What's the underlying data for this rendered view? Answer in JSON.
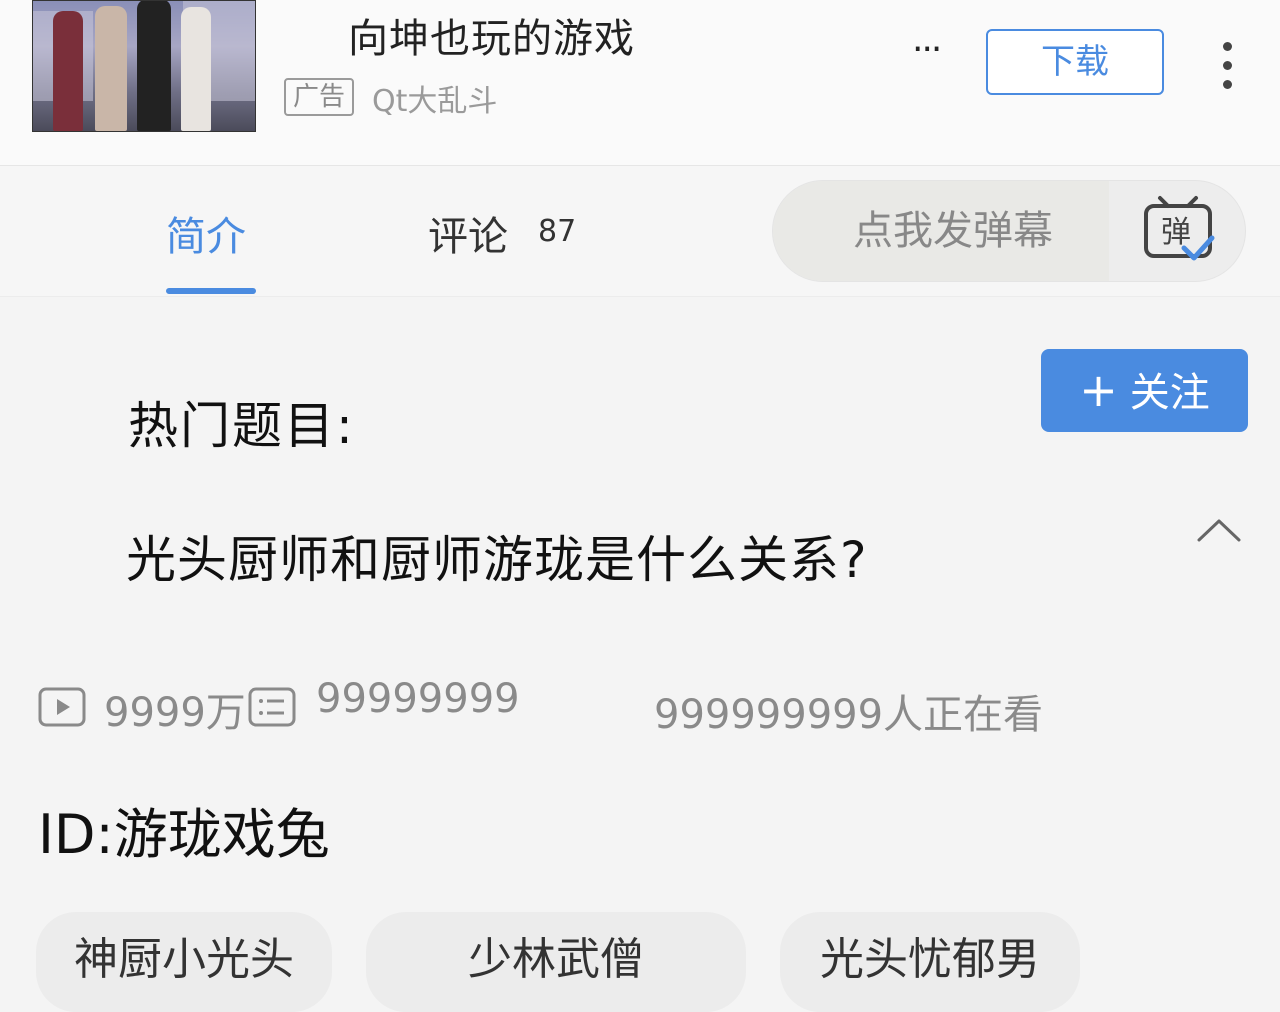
{
  "ad": {
    "title": "向坤也玩的游戏",
    "tag": "广告",
    "brand": "Qt大乱斗",
    "more": "...",
    "download_label": "下载",
    "icons": {
      "more": "ellipsis-icon",
      "menu": "kebab-menu-icon"
    }
  },
  "tabs": {
    "intro_label": "简介",
    "comments_label": "评论",
    "comments_count": "87",
    "danmaku_placeholder": "点我发弹幕",
    "danmaku_icon_glyph": "弹"
  },
  "video": {
    "follow_plus": "+",
    "follow_label": "关注",
    "hot_label": "热门题目:",
    "question": "光头厨师和厨师游珑是什么关系?",
    "views": "9999万",
    "danmu_count": "99999999",
    "watching": "999999999人正在看",
    "id_line": "ID:游珑戏兔",
    "tags": [
      "神厨小光头",
      "少林武僧",
      "光头忧郁男"
    ]
  },
  "colors": {
    "accent": "#4a8be0",
    "background": "#f4f4f4",
    "muted_text": "#8a8a8a"
  }
}
